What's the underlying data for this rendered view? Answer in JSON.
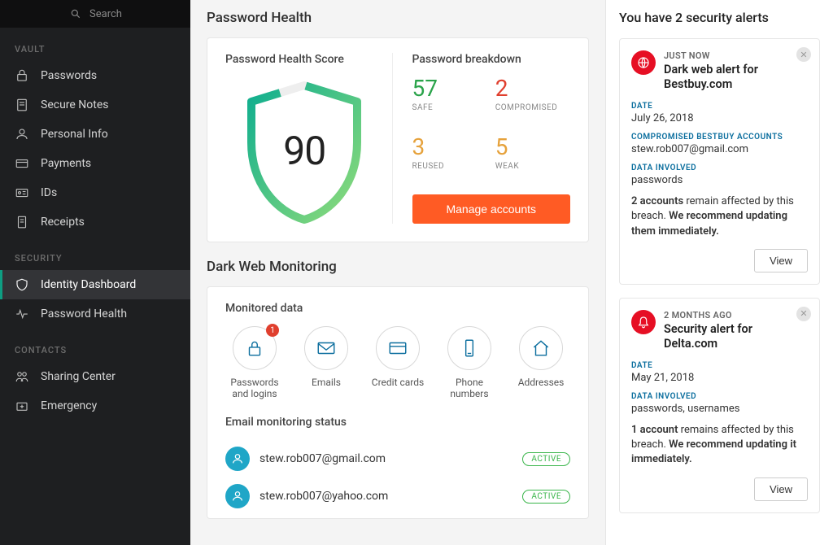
{
  "sidebar": {
    "search_placeholder": "Search",
    "sections": [
      {
        "header": "VAULT",
        "items": [
          {
            "icon": "lock-icon",
            "label": "Passwords"
          },
          {
            "icon": "note-icon",
            "label": "Secure Notes"
          },
          {
            "icon": "person-icon",
            "label": "Personal Info"
          },
          {
            "icon": "card-icon",
            "label": "Payments"
          },
          {
            "icon": "id-icon",
            "label": "IDs"
          },
          {
            "icon": "receipt-icon",
            "label": "Receipts"
          }
        ]
      },
      {
        "header": "SECURITY",
        "items": [
          {
            "icon": "shield-icon",
            "label": "Identity Dashboard",
            "active": true
          },
          {
            "icon": "health-icon",
            "label": "Password Health"
          }
        ]
      },
      {
        "header": "CONTACTS",
        "items": [
          {
            "icon": "share-icon",
            "label": "Sharing Center"
          },
          {
            "icon": "emergency-icon",
            "label": "Emergency"
          }
        ]
      }
    ]
  },
  "password_health": {
    "section_title": "Password Health",
    "score_title": "Password Health Score",
    "score": "90",
    "breakdown_title": "Password breakdown",
    "breakdown": {
      "safe": {
        "value": "57",
        "label": "SAFE"
      },
      "compromised": {
        "value": "2",
        "label": "COMPROMISED"
      },
      "reused": {
        "value": "3",
        "label": "REUSED"
      },
      "weak": {
        "value": "5",
        "label": "WEAK"
      }
    },
    "manage_button": "Manage accounts"
  },
  "dark_web": {
    "section_title": "Dark Web Monitoring",
    "monitored_title": "Monitored data",
    "monitored": [
      {
        "icon": "lock-count-icon",
        "count_badge": "1",
        "label": "Passwords and logins"
      },
      {
        "icon": "mail-icon",
        "label": "Emails"
      },
      {
        "icon": "credit-icon",
        "label": "Credit cards"
      },
      {
        "icon": "phone-icon",
        "label": "Phone numbers"
      },
      {
        "icon": "home-icon",
        "label": "Addresses"
      }
    ],
    "email_title": "Email monitoring status",
    "emails": [
      {
        "address": "stew.rob007@gmail.com",
        "status": "ACTIVE"
      },
      {
        "address": "stew.rob007@yahoo.com",
        "status": "ACTIVE"
      }
    ]
  },
  "alerts": {
    "header": "You have 2 security alerts",
    "items": [
      {
        "time": "JUST NOW",
        "title": "Dark web alert for Bestbuy.com",
        "fields": [
          {
            "label": "DATE",
            "value": "July 26, 2018"
          },
          {
            "label": "COMPROMISED BESTBUY ACCOUNTS",
            "value": "stew.rob007@gmail.com"
          },
          {
            "label": "DATA INVOLVED",
            "value": "passwords"
          }
        ],
        "desc_bold": "2 accounts",
        "desc_rest": " remain affected by this breach. ",
        "desc_bold2": "We recommend updating them immediately.",
        "view": "View"
      },
      {
        "time": "2 MONTHS AGO",
        "title": "Security alert for Delta.com",
        "fields": [
          {
            "label": "DATE",
            "value": "May 21, 2018"
          },
          {
            "label": "DATA INVOLVED",
            "value": "passwords, usernames"
          }
        ],
        "desc_bold": "1 account",
        "desc_rest": " remains affected by this breach. ",
        "desc_bold2": "We recommend updating it immediately.",
        "view": "View"
      }
    ]
  }
}
